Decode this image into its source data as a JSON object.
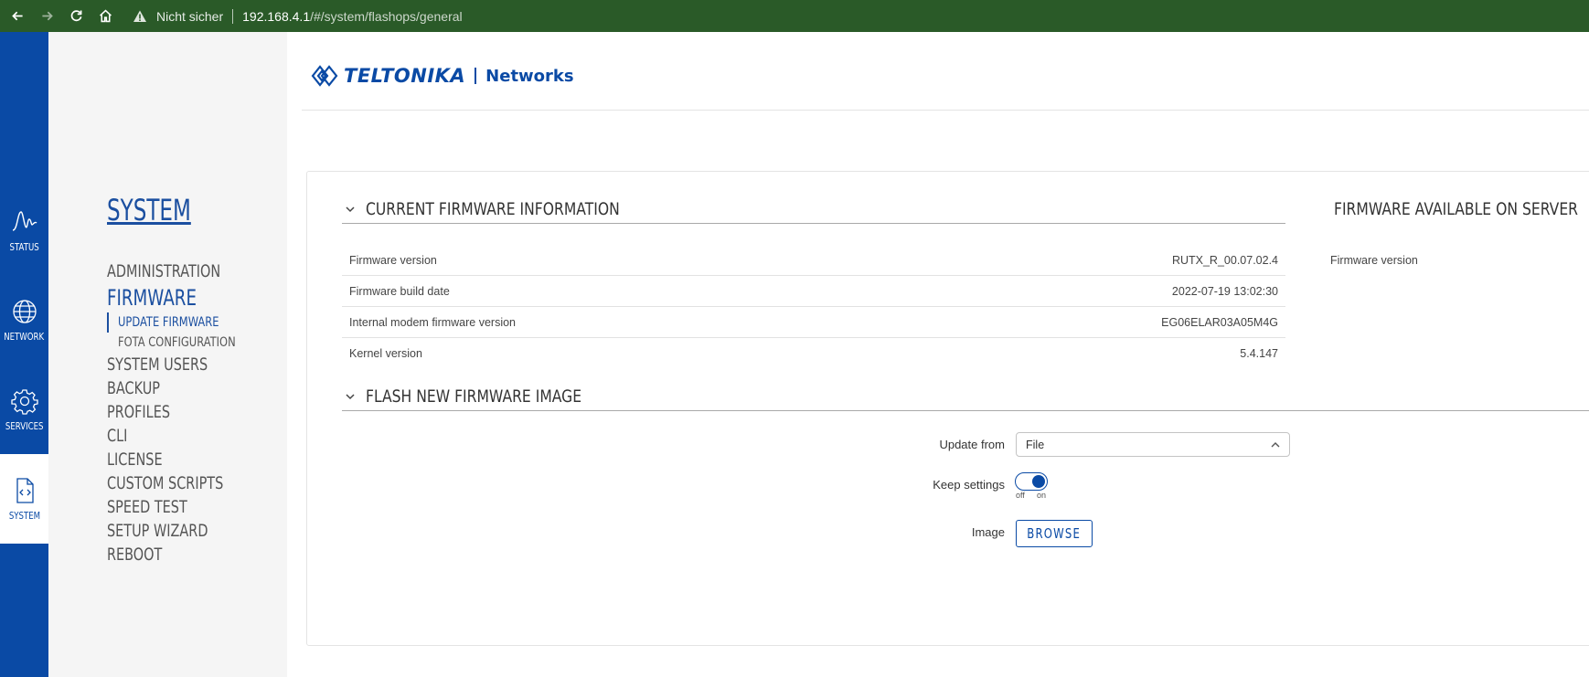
{
  "browser": {
    "security_label": "Nicht sicher",
    "url_host": "192.168.4.1",
    "url_path": "/#/system/flashops/general"
  },
  "iconbar": {
    "items": [
      {
        "label": "STATUS",
        "icon": "status-icon"
      },
      {
        "label": "NETWORK",
        "icon": "network-icon"
      },
      {
        "label": "SERVICES",
        "icon": "services-icon"
      },
      {
        "label": "SYSTEM",
        "icon": "system-icon",
        "active": true
      }
    ]
  },
  "menu": {
    "title": "SYSTEM",
    "items": {
      "administration": "ADMINISTRATION",
      "firmware": "FIRMWARE",
      "update_firmware": "UPDATE FIRMWARE",
      "fota_configuration": "FOTA CONFIGURATION",
      "system_users": "SYSTEM USERS",
      "backup": "BACKUP",
      "profiles": "PROFILES",
      "cli": "CLI",
      "license": "LICENSE",
      "custom_scripts": "CUSTOM SCRIPTS",
      "speed_test": "SPEED TEST",
      "setup_wizard": "SETUP WIZARD",
      "reboot": "REBOOT"
    }
  },
  "header": {
    "brand": "TELTONIKA",
    "product": "Networks"
  },
  "current_firmware": {
    "title": "CURRENT FIRMWARE INFORMATION",
    "rows": [
      {
        "label": "Firmware version",
        "value": "RUTX_R_00.07.02.4"
      },
      {
        "label": "Firmware build date",
        "value": "2022-07-19 13:02:30"
      },
      {
        "label": "Internal modem firmware version",
        "value": "EG06ELAR03A05M4G"
      },
      {
        "label": "Kernel version",
        "value": "5.4.147"
      }
    ]
  },
  "server_firmware": {
    "title": "FIRMWARE AVAILABLE ON SERVER",
    "rows": [
      {
        "label": "Firmware version",
        "value": ""
      }
    ]
  },
  "flash": {
    "title": "FLASH NEW FIRMWARE IMAGE",
    "update_from_label": "Update from",
    "update_from_value": "File",
    "keep_settings_label": "Keep settings",
    "keep_settings_on": true,
    "toggle_off_label": "off",
    "toggle_on_label": "on",
    "image_label": "Image",
    "browse_label": "BROWSE"
  },
  "colors": {
    "brand_blue": "#0a4aa5",
    "browser_green": "#2a5a28",
    "menu_bg": "#f5f5f5"
  }
}
